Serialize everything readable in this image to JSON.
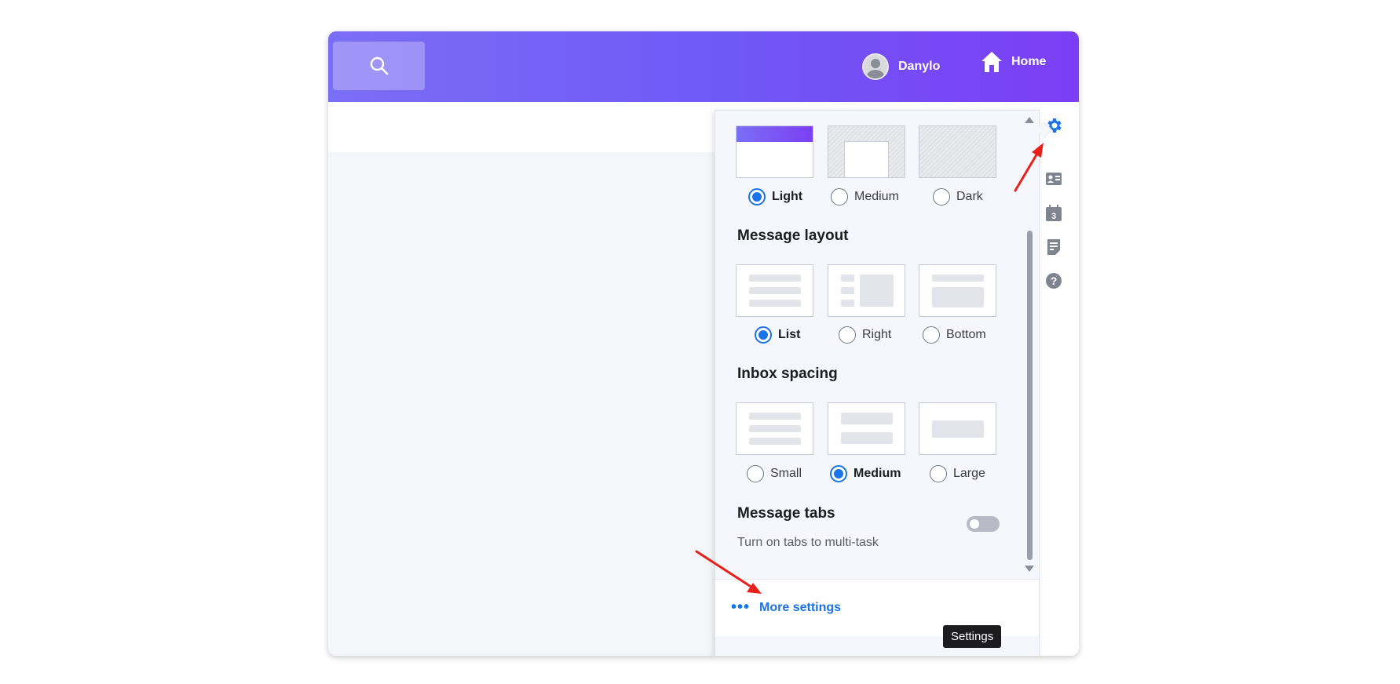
{
  "header": {
    "search_icon": "search-icon",
    "user_name": "Danylo",
    "home_label": "Home"
  },
  "right_rail": {
    "icons": [
      "gear-icon",
      "contacts-card-icon",
      "calendar-icon",
      "notepad-icon",
      "help-icon"
    ],
    "calendar_day": "3"
  },
  "settings_panel": {
    "theme": {
      "options": [
        "Light",
        "Medium",
        "Dark"
      ],
      "selected": "Light"
    },
    "message_layout": {
      "title": "Message layout",
      "options": [
        "List",
        "Right",
        "Bottom"
      ],
      "selected": "List"
    },
    "inbox_spacing": {
      "title": "Inbox spacing",
      "options": [
        "Small",
        "Medium",
        "Large"
      ],
      "selected": "Medium"
    },
    "message_tabs": {
      "title": "Message tabs",
      "description": "Turn on tabs to multi-task",
      "enabled": false
    },
    "footer": {
      "dots": "•••",
      "more_settings": "More settings"
    }
  },
  "tooltip": "Settings",
  "colors": {
    "header_gradient_start": "#7b6ef6",
    "header_gradient_end": "#7b3ef4",
    "accent": "#1a73e8",
    "gear_active": "#1a73e8",
    "annotation_arrow": "#e8201c"
  }
}
